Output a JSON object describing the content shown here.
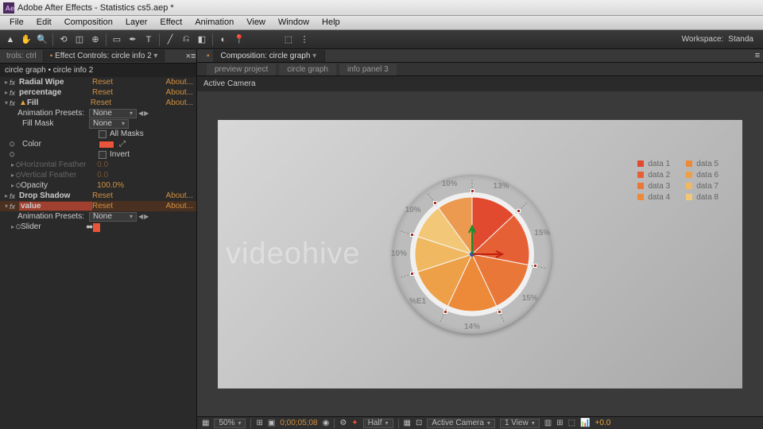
{
  "title": "Adobe After Effects - Statistics cs5.aep *",
  "menus": [
    "File",
    "Edit",
    "Composition",
    "Layer",
    "Effect",
    "Animation",
    "View",
    "Window",
    "Help"
  ],
  "workspace": {
    "label": "Workspace:",
    "value": "Standa"
  },
  "leftTabs": {
    "t1": "trols: ctrl",
    "t2": "Effect Controls: circle info 2"
  },
  "layerPath": "circle graph • circle info 2",
  "effects": {
    "radialWipe": {
      "name": "Radial Wipe",
      "reset": "Reset",
      "about": "About..."
    },
    "percentage": {
      "name": "percentage",
      "reset": "Reset",
      "about": "About..."
    },
    "fill": {
      "name": "Fill",
      "reset": "Reset",
      "about": "About..."
    },
    "presets": {
      "label": "Animation Presets:",
      "value": "None"
    },
    "fillMask": {
      "label": "Fill Mask",
      "value": "None"
    },
    "allMasks": "All Masks",
    "color": "Color",
    "invert": "Invert",
    "hFeather": {
      "label": "Horizontal Feather",
      "val": "0.0"
    },
    "vFeather": {
      "label": "Vertical Feather",
      "val": "0.0"
    },
    "opacity": {
      "label": "Opacity",
      "val": "100.0%"
    },
    "dropShadow": {
      "name": "Drop Shadow",
      "reset": "Reset",
      "about": "About..."
    },
    "value": {
      "name": "value",
      "reset": "Reset",
      "about": "About..."
    },
    "slider": "Slider"
  },
  "compTab": "Composition: circle graph",
  "subTabs": [
    "preview project",
    "circle graph",
    "info panel 3"
  ],
  "camera": "Active Camera",
  "watermark": "videohive",
  "legend": [
    {
      "name": "data 1",
      "color": "#e14a2e"
    },
    {
      "name": "data 5",
      "color": "#ec8a3a"
    },
    {
      "name": "data 2",
      "color": "#e66035"
    },
    {
      "name": "data 6",
      "color": "#eea048"
    },
    {
      "name": "data 3",
      "color": "#e97838"
    },
    {
      "name": "data 7",
      "color": "#f0b860"
    },
    {
      "name": "data 4",
      "color": "#ec8a3a"
    },
    {
      "name": "data 8",
      "color": "#f2c878"
    }
  ],
  "chart_data": {
    "type": "pie",
    "title": "",
    "series": [
      {
        "name": "circle graph",
        "values": [
          13,
          15,
          15,
          14,
          13,
          10,
          10,
          10
        ]
      }
    ],
    "categories": [
      "data 1",
      "data 2",
      "data 3",
      "data 4",
      "data 5",
      "data 6",
      "data 7",
      "data 8"
    ],
    "colors": [
      "#e14a2e",
      "#e66035",
      "#e97838",
      "#ec8a3a",
      "#eea048",
      "#f0b860",
      "#f2c878",
      "#ec9a50"
    ],
    "labels": [
      "13%",
      "15%",
      "15%",
      "14%",
      "%E1",
      "10%",
      "10%",
      "10%"
    ]
  },
  "footer": {
    "zoom": "50%",
    "time": "0;00;05;08",
    "res": "Half",
    "cam": "Active Camera",
    "view": "1 View",
    "exp": "+0.0"
  }
}
